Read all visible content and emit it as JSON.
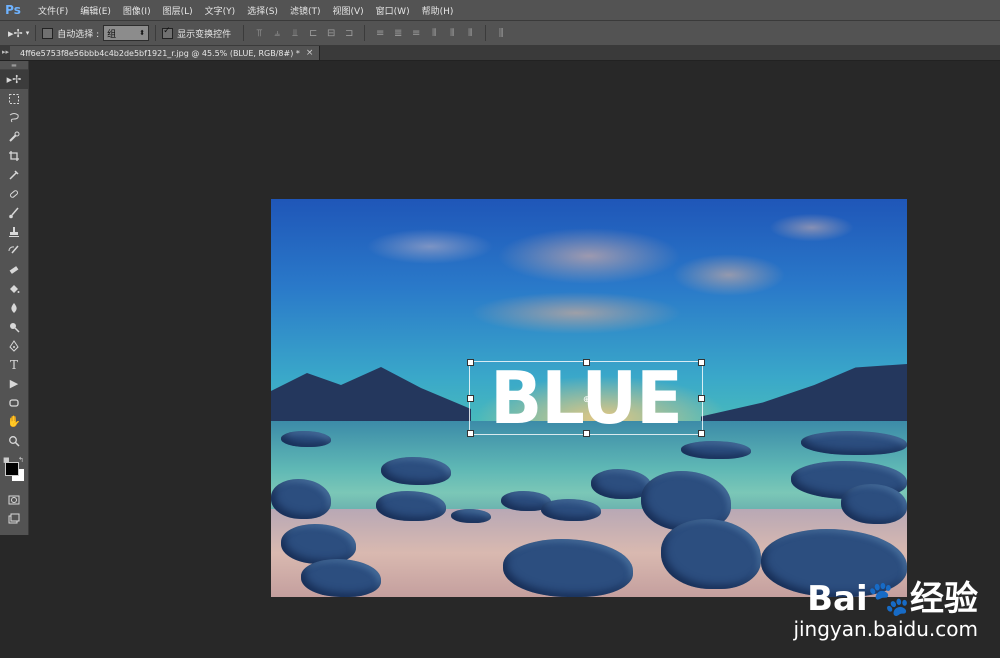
{
  "app": {
    "logo": "Ps"
  },
  "menu": [
    "文件(F)",
    "编辑(E)",
    "图像(I)",
    "图层(L)",
    "文字(Y)",
    "选择(S)",
    "滤镜(T)",
    "视图(V)",
    "窗口(W)",
    "帮助(H)"
  ],
  "options": {
    "tool_icon": "move-tool-icon",
    "auto_select_label": "自动选择 :",
    "auto_select_value": "组",
    "show_transform_label": "显示变换控件"
  },
  "document": {
    "tab_title": "4ff6e5753f8e56bbb4c4b2de5bf1921_r.jpg @ 45.5% (BLUE, RGB/8#) *",
    "close_glyph": "×"
  },
  "tools": [
    "move-tool",
    "rectangular-marquee-tool",
    "lasso-tool",
    "quick-selection-tool",
    "crop-tool",
    "eyedropper-tool",
    "spot-healing-tool",
    "brush-tool",
    "clone-stamp-tool",
    "history-brush-tool",
    "eraser-tool",
    "paint-bucket-tool",
    "blur-tool",
    "dodge-tool",
    "pen-tool",
    "type-tool",
    "path-selection-tool",
    "rectangle-tool",
    "hand-tool",
    "zoom-tool"
  ],
  "colors": {
    "foreground": "#000000",
    "background": "#ffffff",
    "accent": "#6fb3ff"
  },
  "canvas": {
    "text_layer": "BLUE"
  },
  "watermark": {
    "logo": "Bai🐾经验",
    "url": "jingyan.baidu.com"
  }
}
